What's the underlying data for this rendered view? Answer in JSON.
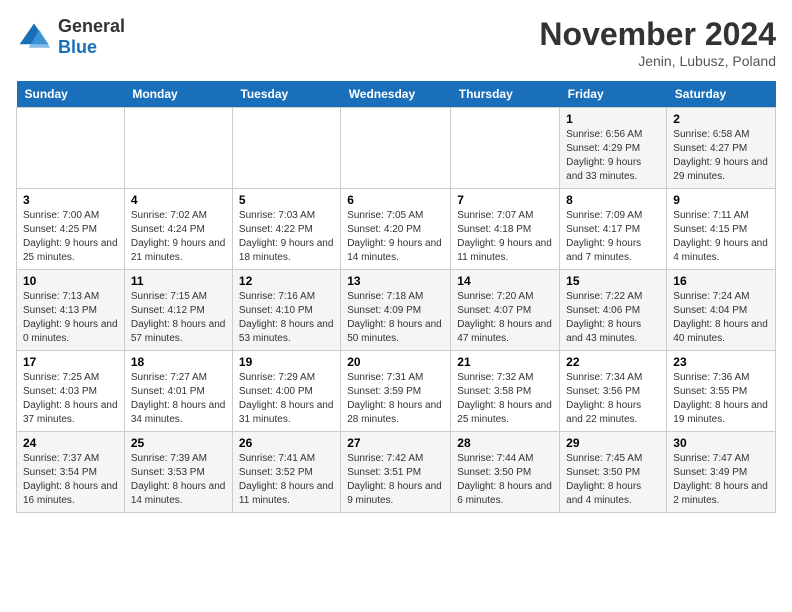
{
  "logo": {
    "general": "General",
    "blue": "Blue"
  },
  "header": {
    "month": "November 2024",
    "location": "Jenin, Lubusz, Poland"
  },
  "days_of_week": [
    "Sunday",
    "Monday",
    "Tuesday",
    "Wednesday",
    "Thursday",
    "Friday",
    "Saturday"
  ],
  "weeks": [
    [
      {
        "day": "",
        "info": ""
      },
      {
        "day": "",
        "info": ""
      },
      {
        "day": "",
        "info": ""
      },
      {
        "day": "",
        "info": ""
      },
      {
        "day": "",
        "info": ""
      },
      {
        "day": "1",
        "info": "Sunrise: 6:56 AM\nSunset: 4:29 PM\nDaylight: 9 hours and 33 minutes."
      },
      {
        "day": "2",
        "info": "Sunrise: 6:58 AM\nSunset: 4:27 PM\nDaylight: 9 hours and 29 minutes."
      }
    ],
    [
      {
        "day": "3",
        "info": "Sunrise: 7:00 AM\nSunset: 4:25 PM\nDaylight: 9 hours and 25 minutes."
      },
      {
        "day": "4",
        "info": "Sunrise: 7:02 AM\nSunset: 4:24 PM\nDaylight: 9 hours and 21 minutes."
      },
      {
        "day": "5",
        "info": "Sunrise: 7:03 AM\nSunset: 4:22 PM\nDaylight: 9 hours and 18 minutes."
      },
      {
        "day": "6",
        "info": "Sunrise: 7:05 AM\nSunset: 4:20 PM\nDaylight: 9 hours and 14 minutes."
      },
      {
        "day": "7",
        "info": "Sunrise: 7:07 AM\nSunset: 4:18 PM\nDaylight: 9 hours and 11 minutes."
      },
      {
        "day": "8",
        "info": "Sunrise: 7:09 AM\nSunset: 4:17 PM\nDaylight: 9 hours and 7 minutes."
      },
      {
        "day": "9",
        "info": "Sunrise: 7:11 AM\nSunset: 4:15 PM\nDaylight: 9 hours and 4 minutes."
      }
    ],
    [
      {
        "day": "10",
        "info": "Sunrise: 7:13 AM\nSunset: 4:13 PM\nDaylight: 9 hours and 0 minutes."
      },
      {
        "day": "11",
        "info": "Sunrise: 7:15 AM\nSunset: 4:12 PM\nDaylight: 8 hours and 57 minutes."
      },
      {
        "day": "12",
        "info": "Sunrise: 7:16 AM\nSunset: 4:10 PM\nDaylight: 8 hours and 53 minutes."
      },
      {
        "day": "13",
        "info": "Sunrise: 7:18 AM\nSunset: 4:09 PM\nDaylight: 8 hours and 50 minutes."
      },
      {
        "day": "14",
        "info": "Sunrise: 7:20 AM\nSunset: 4:07 PM\nDaylight: 8 hours and 47 minutes."
      },
      {
        "day": "15",
        "info": "Sunrise: 7:22 AM\nSunset: 4:06 PM\nDaylight: 8 hours and 43 minutes."
      },
      {
        "day": "16",
        "info": "Sunrise: 7:24 AM\nSunset: 4:04 PM\nDaylight: 8 hours and 40 minutes."
      }
    ],
    [
      {
        "day": "17",
        "info": "Sunrise: 7:25 AM\nSunset: 4:03 PM\nDaylight: 8 hours and 37 minutes."
      },
      {
        "day": "18",
        "info": "Sunrise: 7:27 AM\nSunset: 4:01 PM\nDaylight: 8 hours and 34 minutes."
      },
      {
        "day": "19",
        "info": "Sunrise: 7:29 AM\nSunset: 4:00 PM\nDaylight: 8 hours and 31 minutes."
      },
      {
        "day": "20",
        "info": "Sunrise: 7:31 AM\nSunset: 3:59 PM\nDaylight: 8 hours and 28 minutes."
      },
      {
        "day": "21",
        "info": "Sunrise: 7:32 AM\nSunset: 3:58 PM\nDaylight: 8 hours and 25 minutes."
      },
      {
        "day": "22",
        "info": "Sunrise: 7:34 AM\nSunset: 3:56 PM\nDaylight: 8 hours and 22 minutes."
      },
      {
        "day": "23",
        "info": "Sunrise: 7:36 AM\nSunset: 3:55 PM\nDaylight: 8 hours and 19 minutes."
      }
    ],
    [
      {
        "day": "24",
        "info": "Sunrise: 7:37 AM\nSunset: 3:54 PM\nDaylight: 8 hours and 16 minutes."
      },
      {
        "day": "25",
        "info": "Sunrise: 7:39 AM\nSunset: 3:53 PM\nDaylight: 8 hours and 14 minutes."
      },
      {
        "day": "26",
        "info": "Sunrise: 7:41 AM\nSunset: 3:52 PM\nDaylight: 8 hours and 11 minutes."
      },
      {
        "day": "27",
        "info": "Sunrise: 7:42 AM\nSunset: 3:51 PM\nDaylight: 8 hours and 9 minutes."
      },
      {
        "day": "28",
        "info": "Sunrise: 7:44 AM\nSunset: 3:50 PM\nDaylight: 8 hours and 6 minutes."
      },
      {
        "day": "29",
        "info": "Sunrise: 7:45 AM\nSunset: 3:50 PM\nDaylight: 8 hours and 4 minutes."
      },
      {
        "day": "30",
        "info": "Sunrise: 7:47 AM\nSunset: 3:49 PM\nDaylight: 8 hours and 2 minutes."
      }
    ]
  ]
}
